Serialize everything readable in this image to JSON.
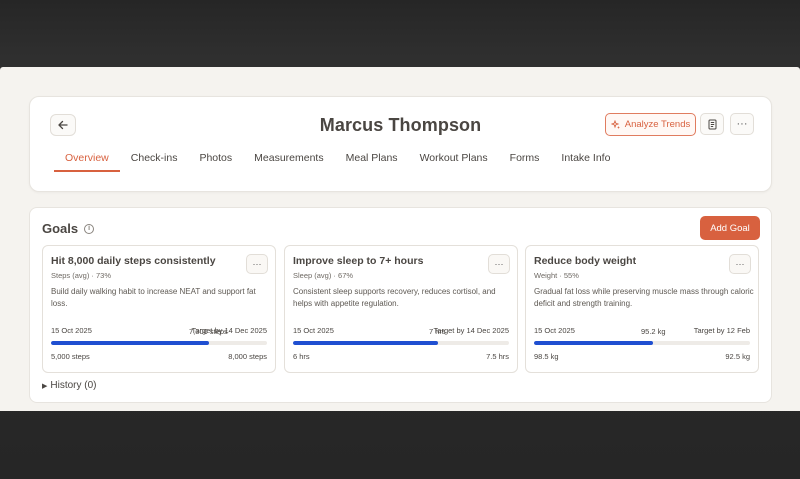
{
  "header": {
    "client_name": "Marcus Thompson",
    "analyze_label": "Analyze Trends",
    "more_label": "···"
  },
  "tabs": [
    {
      "label": "Overview",
      "active": true
    },
    {
      "label": "Check-ins",
      "active": false
    },
    {
      "label": "Photos",
      "active": false
    },
    {
      "label": "Measurements",
      "active": false
    },
    {
      "label": "Meal Plans",
      "active": false
    },
    {
      "label": "Workout Plans",
      "active": false
    },
    {
      "label": "Forms",
      "active": false
    },
    {
      "label": "Intake Info",
      "active": false
    }
  ],
  "goals_section": {
    "title": "Goals",
    "add_label": "Add Goal",
    "history_label": "History (0)"
  },
  "goals": [
    {
      "title": "Hit 8,000 daily steps consistently",
      "meta": "Steps (avg) · 73%",
      "description": "Build daily walking habit to increase NEAT and support fat loss.",
      "start_date": "15 Oct 2025",
      "current": "7,300 steps",
      "target": "Target by 14 Dec 2025",
      "baseline": "5,000 steps",
      "goal_value": "8,000 steps",
      "progress": 0.73
    },
    {
      "title": "Improve sleep to 7+ hours",
      "meta": "Sleep (avg) · 67%",
      "description": "Consistent sleep supports recovery, reduces cortisol, and helps with appetite regulation.",
      "start_date": "15 Oct 2025",
      "current": "7 hrs",
      "target": "Target by 14 Dec 2025",
      "baseline": "6 hrs",
      "goal_value": "7.5 hrs",
      "progress": 0.67
    },
    {
      "title": "Reduce body weight",
      "meta": "Weight · 55%",
      "description": "Gradual fat loss while preserving muscle mass through caloric deficit and strength training.",
      "start_date": "15 Oct 2025",
      "current": "95.2 kg",
      "target": "Target by 12 Feb",
      "baseline": "98.5 kg",
      "goal_value": "92.5 kg",
      "progress": 0.55
    }
  ],
  "colors": {
    "accent": "#d8613f",
    "progress": "#1f4fd1"
  }
}
